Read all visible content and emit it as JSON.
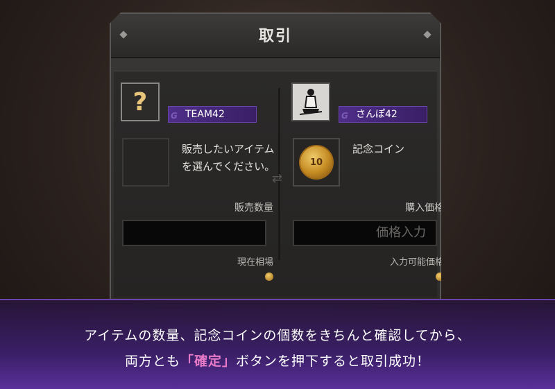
{
  "window": {
    "title": "取引"
  },
  "seller": {
    "name": "TEAM42",
    "slot_text": "販売したいアイテムを選んでください。",
    "quantity_label": "販売数量",
    "quantity_value": "",
    "market_label": "現在相場"
  },
  "buyer": {
    "name": "さんぽ42",
    "item_name": "記念コイン",
    "price_label": "購入価格",
    "price_placeholder": "価格入力",
    "available_label": "入力可能価格"
  },
  "caption": {
    "line1": "アイテムの数量、記念コインの個数をきちんと確認してから、",
    "line2_pre": "両方とも",
    "line2_highlight": "「確定」",
    "line2_post": "ボタンを押下すると取引成功！"
  },
  "colors": {
    "accent": "#4e2e88",
    "highlight": "#e87ac8"
  },
  "icons": {
    "unknown_avatar": "question-mark-icon",
    "user_avatar": "samurai-icon",
    "coin": "coin-icon"
  }
}
